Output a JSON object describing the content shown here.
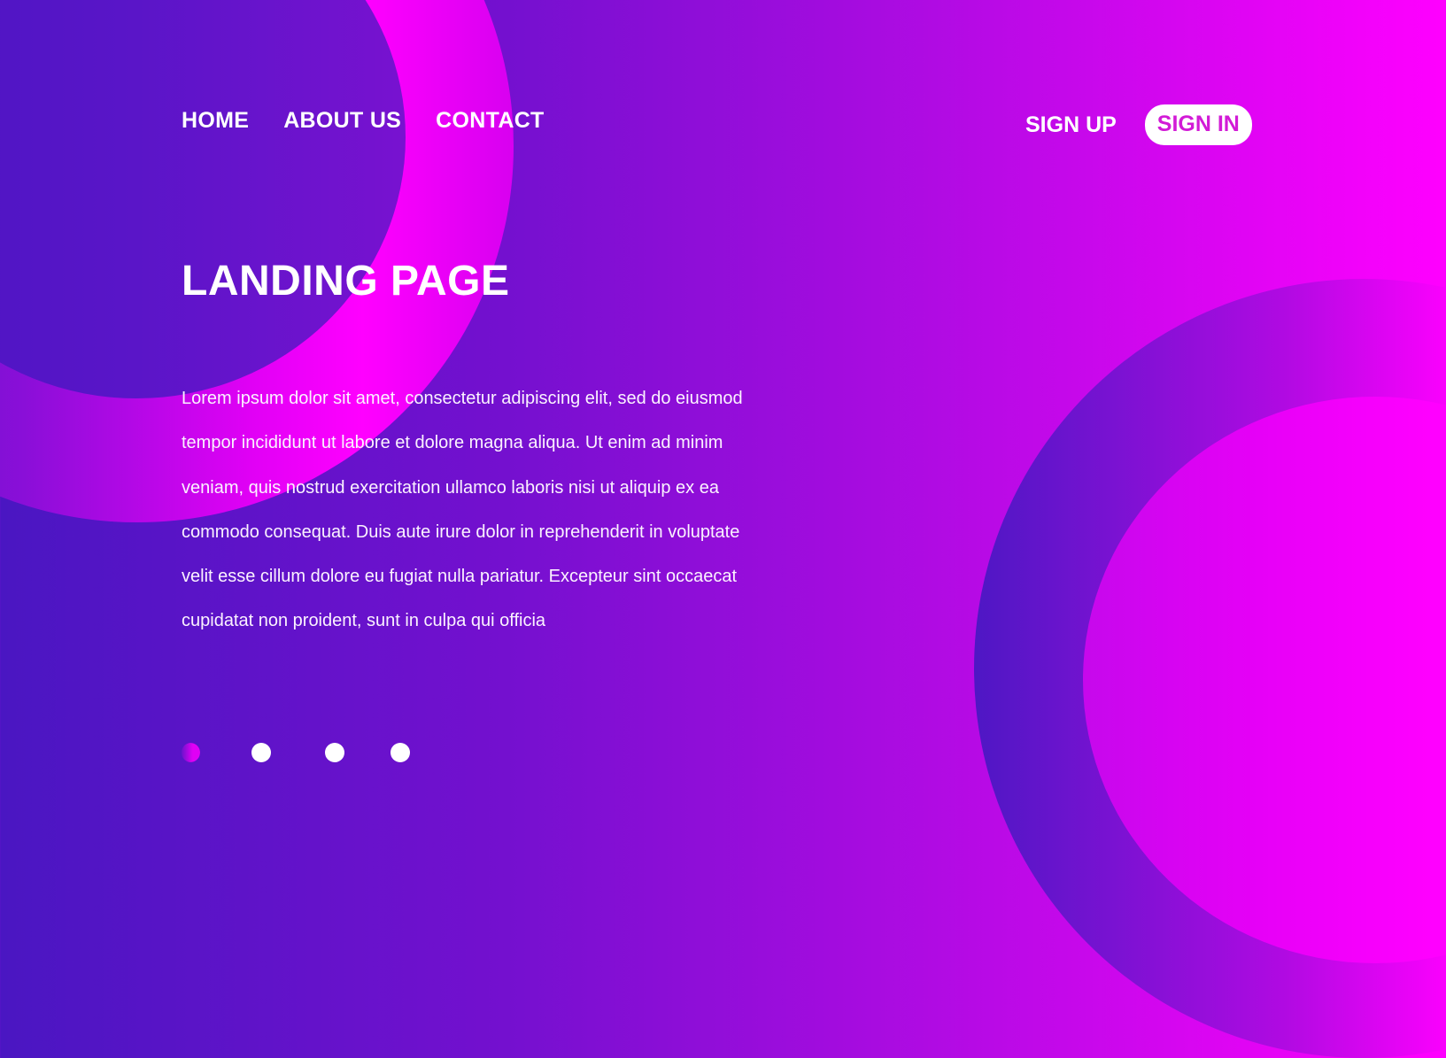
{
  "nav": {
    "items": [
      {
        "label": "HOME"
      },
      {
        "label": "ABOUT US"
      },
      {
        "label": "CONTACT"
      }
    ]
  },
  "auth": {
    "signup_label": "SIGN UP",
    "signin_label": "SIGN IN"
  },
  "hero": {
    "title": "LANDING PAGE",
    "lines": [
      "Lorem ipsum dolor sit amet, consectetur adipiscing elit, sed do eiusmod",
      "tempor incididunt ut labore et dolore magna aliqua. Ut enim ad minim",
      "veniam, quis nostrud exercitation ullamco laboris nisi ut aliquip ex ea",
      "commodo consequat. Duis aute irure dolor in reprehenderit in voluptate",
      "velit esse cillum dolore eu fugiat nulla pariatur. Excepteur sint occaecat",
      "cupidatat non proident, sunt in culpa qui officia"
    ]
  },
  "carousel": {
    "slide_count": 4,
    "active_index": 0
  },
  "colors": {
    "gradient_start": "#4a16c2",
    "gradient_end": "#ff00ff",
    "signin_text": "#d21bd6",
    "text": "#ffffff"
  }
}
